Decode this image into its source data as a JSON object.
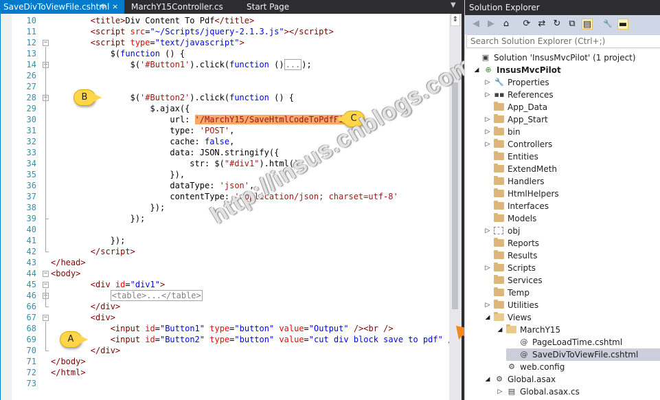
{
  "tabs": [
    {
      "label": "SaveDivToViewFile.cshtml",
      "pin": "⊕",
      "close": "×",
      "active": true
    },
    {
      "label": "MarchY15Controller.cs"
    },
    {
      "label": "Start Page"
    }
  ],
  "editor": {
    "line_numbers": [
      "10",
      "11",
      "12",
      "13",
      "14",
      "26",
      "27",
      "28",
      "29",
      "30",
      "31",
      "32",
      "33",
      "34",
      "35",
      "36",
      "37",
      "38",
      "39",
      "40",
      "41",
      "42",
      "43",
      "44",
      "45",
      "46",
      "66",
      "67",
      "68",
      "69",
      "70",
      "71",
      "72",
      "73"
    ],
    "lines": [
      "        <span class=\"tag\">&lt;title&gt;</span>Div Content To Pdf<span class=\"tag\">&lt;/title&gt;</span>",
      "        <span class=\"tag\">&lt;script</span> <span class=\"attr\">src</span>=<span class=\"kw\">\"~/Scripts/jquery-2.1.3.js\"</span><span class=\"tag\">&gt;&lt;/script&gt;</span>",
      "        <span class=\"tag\">&lt;script</span> <span class=\"attr\">type</span>=<span class=\"kw\">\"text/javascript\"</span><span class=\"tag\">&gt;</span>",
      "            $(<span class=\"kw\">function</span> () {",
      "                $(<span class=\"str\">'#Button1'</span>).click(<span class=\"kw\">function</span> ()<span class=\"collapsed\">...</span>);",
      "",
      "",
      "                $(<span class=\"str\">'#Button2'</span>).click(<span class=\"kw\">function</span> () {",
      "                    $.ajax({",
      "                        url: <span class=\"hl\">'/MarchY15/SaveHtmlCodeToPdfFile'</span>,",
      "                        type: <span class=\"str\">'POST'</span>,",
      "                        cache: <span class=\"kw\">false</span>,",
      "                        data: JSON.stringify({",
      "                            str: $(<span class=\"str\">\"#div1\"</span>).html()",
      "                        }),",
      "                        dataType: <span class=\"str\">'json'</span>,",
      "                        contentType: <span class=\"str\">'application/json; charset=utf-8'</span>",
      "                    });",
      "                });",
      "",
      "            });",
      "        <span class=\"tag\">&lt;/script&gt;</span>",
      "<span class=\"tag\">&lt;/head&gt;</span>",
      "<span class=\"tag\">&lt;body&gt;</span>",
      "        <span class=\"tag\">&lt;div</span> <span class=\"attr\">id</span>=<span class=\"kw\">\"div1\"</span><span class=\"tag\">&gt;</span>",
      "            <span class=\"collapsed\">&lt;table&gt;...&lt;/table&gt;</span>",
      "        <span class=\"tag\">&lt;/div&gt;</span>",
      "        <span class=\"tag\">&lt;div&gt;</span>",
      "            <span class=\"tag\">&lt;input</span> <span class=\"attr\">id</span>=<span class=\"kw\">\"Button1\"</span> <span class=\"attr\">type</span>=<span class=\"kw\">\"button\"</span> <span class=\"attr\">value</span>=<span class=\"kw\">\"Output\"</span> <span class=\"tag\">/&gt;&lt;br /&gt;</span>",
      "            <span class=\"tag\">&lt;input</span> <span class=\"attr\">id</span>=<span class=\"kw\">\"Button2\"</span> <span class=\"attr\">type</span>=<span class=\"kw\">\"button\"</span> <span class=\"attr\">value</span>=<span class=\"kw\">\"cut div block save to pdf\"</span> <span class=\"tag\">/&gt;</span>",
      "        <span class=\"tag\">&lt;/div&gt;</span>",
      "<span class=\"tag\">&lt;/body&gt;</span>",
      "<span class=\"tag\">&lt;/html&gt;</span>",
      ""
    ],
    "callouts": {
      "a": "A",
      "b": "B",
      "c": "C"
    },
    "watermark": "http://insus.cnblogs.com",
    "split_icon": "⇕"
  },
  "solution_explorer": {
    "title": "Solution Explorer",
    "search_placeholder": "Search Solution Explorer (Ctrl+;)",
    "toolbar": {
      "back": "◀",
      "forward": "▶",
      "home": "⌂",
      "history": "⟳",
      "sync": "⇄",
      "refresh": "↻",
      "collapse": "⧉",
      "show_all": "▤",
      "properties": "🔧",
      "preview": "▬"
    },
    "tree": [
      {
        "label": "Solution 'InsusMvcPilot' (1 project)",
        "twisty": "",
        "icon": "solution-icon"
      },
      {
        "label": "InsusMvcPilot",
        "twisty": "◢",
        "icon": "web-project-icon",
        "bold": true
      },
      {
        "label": "Properties",
        "twisty": "▷",
        "icon": "wrench-icon"
      },
      {
        "label": "References",
        "twisty": "▷",
        "icon": "references-icon"
      },
      {
        "label": "App_Data",
        "twisty": "",
        "icon": "folder-icon"
      },
      {
        "label": "App_Start",
        "twisty": "▷",
        "icon": "folder-icon"
      },
      {
        "label": "bin",
        "twisty": "▷",
        "icon": "folder-icon"
      },
      {
        "label": "Controllers",
        "twisty": "▷",
        "icon": "folder-icon"
      },
      {
        "label": "Entities",
        "twisty": "",
        "icon": "folder-icon"
      },
      {
        "label": "ExtendMeth",
        "twisty": "",
        "icon": "folder-icon"
      },
      {
        "label": "Handlers",
        "twisty": "",
        "icon": "folder-icon"
      },
      {
        "label": "HtmlHelpers",
        "twisty": "",
        "icon": "folder-icon"
      },
      {
        "label": "Interfaces",
        "twisty": "",
        "icon": "folder-icon"
      },
      {
        "label": "Models",
        "twisty": "",
        "icon": "folder-icon"
      },
      {
        "label": "obj",
        "twisty": "▷",
        "icon": "dashed-folder-icon"
      },
      {
        "label": "Reports",
        "twisty": "",
        "icon": "folder-icon"
      },
      {
        "label": "Results",
        "twisty": "",
        "icon": "folder-icon"
      },
      {
        "label": "Scripts",
        "twisty": "▷",
        "icon": "folder-icon"
      },
      {
        "label": "Services",
        "twisty": "",
        "icon": "folder-icon"
      },
      {
        "label": "Temp",
        "twisty": "",
        "icon": "folder-icon"
      },
      {
        "label": "Utilities",
        "twisty": "▷",
        "icon": "folder-icon"
      },
      {
        "label": "Views",
        "twisty": "◢",
        "icon": "open-folder-icon"
      },
      {
        "label": "MarchY15",
        "twisty": "◢",
        "icon": "open-folder-icon"
      },
      {
        "label": "PageLoadTime.cshtml",
        "twisty": "",
        "icon": "razor-file-icon"
      },
      {
        "label": "SaveDivToViewFile.cshtml",
        "twisty": "",
        "icon": "razor-file-icon",
        "selected": true
      },
      {
        "label": "web.config",
        "twisty": "",
        "icon": "config-file-icon"
      },
      {
        "label": "Global.asax",
        "twisty": "◢",
        "icon": "global-asax-icon"
      },
      {
        "label": "Global.asax.cs",
        "twisty": "▷",
        "icon": "cs-file-icon"
      }
    ]
  },
  "colors": {
    "accent": "#007acc",
    "highlight": "#f7a86a",
    "callout": "#ffd54a",
    "arrow": "#f28a1e"
  }
}
